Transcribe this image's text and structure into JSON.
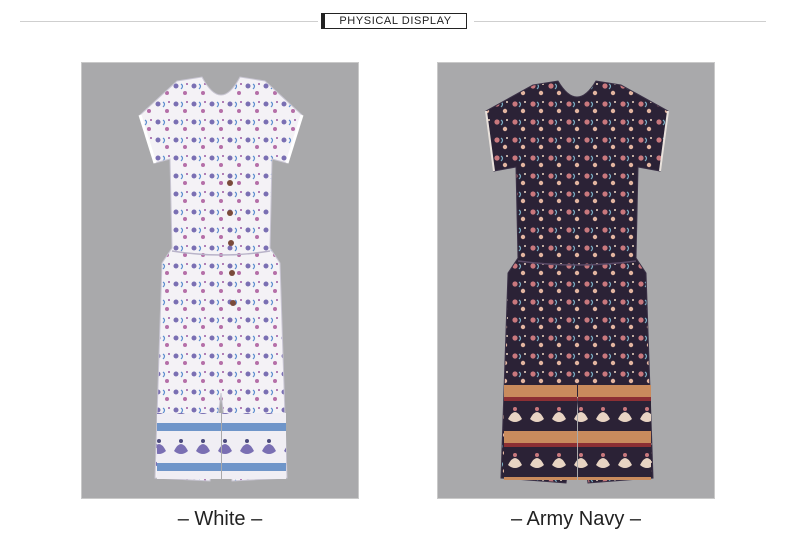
{
  "header": {
    "title": "PHYSICAL DISPLAY"
  },
  "products": [
    {
      "color_name": "White",
      "caption": "– White –",
      "fabric_color": "#f4f2f6",
      "print_color": "#7a6fb3",
      "border_color": "#6f95c9"
    },
    {
      "color_name": "Army Navy",
      "caption": "– Army Navy –",
      "fabric_color": "#2b2236",
      "print_color": "#c9787d",
      "border_color": "#c98b5d"
    }
  ],
  "colors": {
    "panel_bg": "#a9a9ab",
    "text": "#222222",
    "rule": "#cfcfcf"
  }
}
